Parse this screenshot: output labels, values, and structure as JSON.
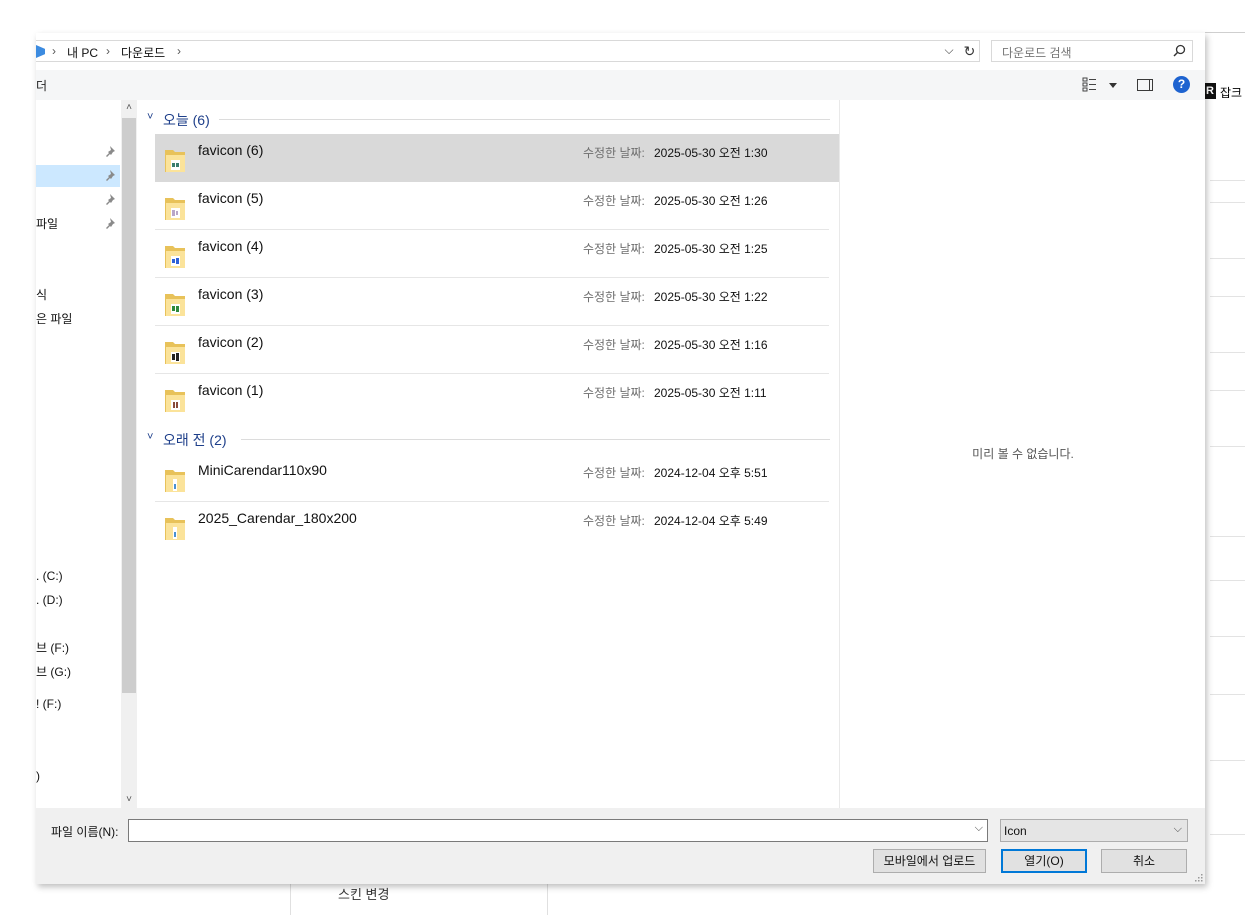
{
  "background": {
    "right_tag_letter": "R",
    "right_tag_text": "잡크",
    "bottom_text": "스킨 변경"
  },
  "address": {
    "crumbs": [
      "내 PC",
      "다운로드"
    ],
    "separator": "›",
    "dropdown_glyph": "⌵",
    "refresh_glyph": "↻"
  },
  "search": {
    "placeholder": "다운로드 검색"
  },
  "toolbar": {
    "left_label": "더",
    "help_label": "?"
  },
  "nav": {
    "items": [
      {
        "label": "",
        "pinned": true,
        "selected": false
      },
      {
        "label": "",
        "pinned": true,
        "selected": true
      },
      {
        "label": "",
        "pinned": true,
        "selected": false
      },
      {
        "label": "파일",
        "pinned": true,
        "selected": false
      },
      {
        "label": "식",
        "pinned": false,
        "selected": false
      },
      {
        "label": "은 파일",
        "pinned": false,
        "selected": false
      },
      {
        "label": ". (C:)",
        "pinned": false,
        "selected": false
      },
      {
        "label": ". (D:)",
        "pinned": false,
        "selected": false
      },
      {
        "label": "브 (F:)",
        "pinned": false,
        "selected": false
      },
      {
        "label": "브 (G:)",
        "pinned": false,
        "selected": false
      },
      {
        "label": "! (F:)",
        "pinned": false,
        "selected": false
      },
      {
        "label": ")",
        "pinned": false,
        "selected": false
      }
    ],
    "scroll_up": "˄",
    "scroll_down": "˅"
  },
  "groups": [
    {
      "title": "오늘 (6)",
      "chevron": "˅",
      "files": [
        {
          "name": "favicon (6)",
          "modified_label": "수정한 날짜:",
          "modified": "2025-05-30 오전 1:30",
          "selected": true,
          "accent": "#3a7d6e"
        },
        {
          "name": "favicon (5)",
          "modified_label": "수정한 날짜:",
          "modified": "2025-05-30 오전 1:26",
          "selected": false,
          "accent": "#b9a6c8"
        },
        {
          "name": "favicon (4)",
          "modified_label": "수정한 날짜:",
          "modified": "2025-05-30 오전 1:25",
          "selected": false,
          "accent": "#2f62d8"
        },
        {
          "name": "favicon (3)",
          "modified_label": "수정한 날짜:",
          "modified": "2025-05-30 오전 1:22",
          "selected": false,
          "accent": "#2e8b3c"
        },
        {
          "name": "favicon (2)",
          "modified_label": "수정한 날짜:",
          "modified": "2025-05-30 오전 1:16",
          "selected": false,
          "accent": "#222222"
        },
        {
          "name": "favicon (1)",
          "modified_label": "수정한 날짜:",
          "modified": "2025-05-30 오전 1:11",
          "selected": false,
          "accent": "#8a4a3a"
        }
      ]
    },
    {
      "title": "오래 전 (2)",
      "chevron": "˅",
      "files": [
        {
          "name": "MiniCarendar110x90",
          "modified_label": "수정한 날짜:",
          "modified": "2024-12-04 오후 5:51",
          "selected": false,
          "accent": "#4a90d0"
        },
        {
          "name": "2025_Carendar_180x200",
          "modified_label": "수정한 날짜:",
          "modified": "2024-12-04 오후 5:49",
          "selected": false,
          "accent": "#4a90d0"
        }
      ]
    }
  ],
  "preview": {
    "message": "미리 볼 수 없습니다."
  },
  "footer": {
    "filename_label": "파일 이름(N):",
    "filename_value": "",
    "filter_value": "Icon",
    "dropdown_glyph": "⌵",
    "upload_button": "모바일에서 업로드",
    "open_button": "열기(O)",
    "cancel_button": "취소"
  },
  "colors": {
    "accent_blue": "#0078d7",
    "group_title": "#1e3f8a",
    "selection": "#d9d9d9",
    "nav_selection": "#cce8ff"
  }
}
